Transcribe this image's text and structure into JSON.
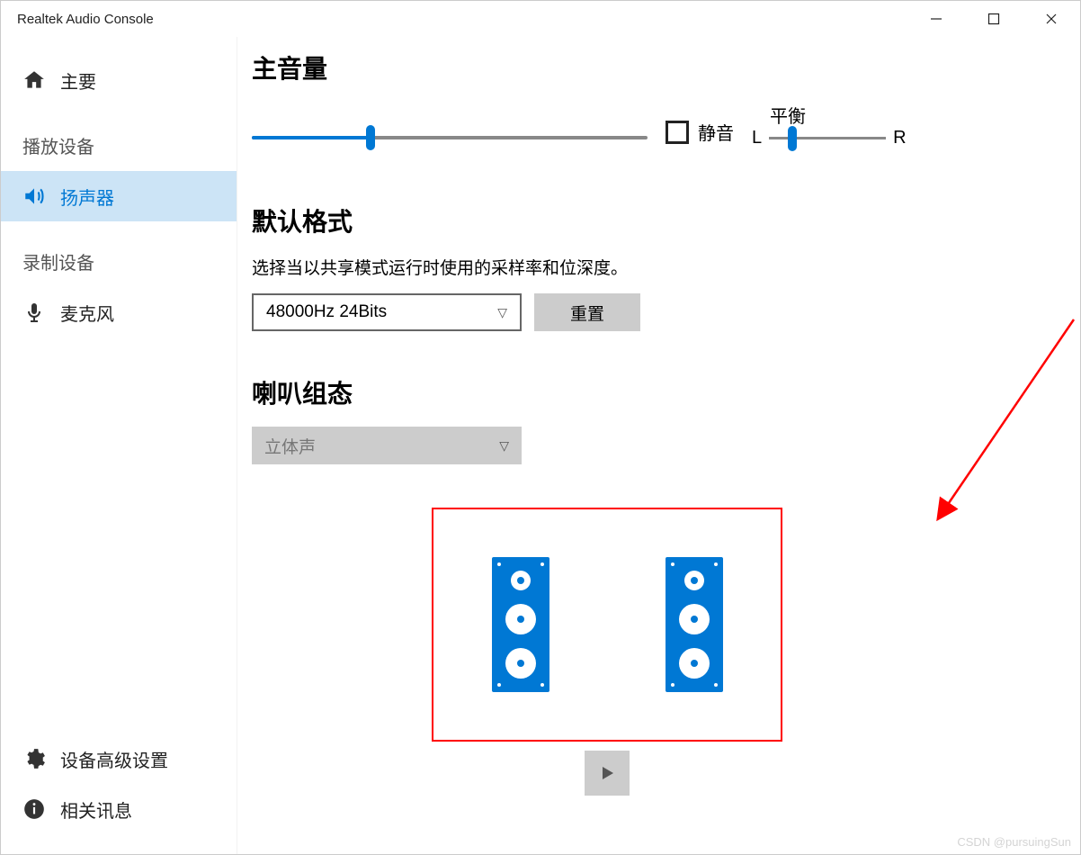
{
  "window": {
    "title": "Realtek Audio Console"
  },
  "sidebar": {
    "main": "主要",
    "playback_section": "播放设备",
    "speaker": "扬声器",
    "record_section": "录制设备",
    "microphone": "麦克风",
    "advanced": "设备高级设置",
    "info": "相关讯息"
  },
  "main": {
    "volume_title": "主音量",
    "volume_percent": 30,
    "mute_label": "静音",
    "balance_label": "平衡",
    "balance_left": "L",
    "balance_right": "R",
    "balance_percent": 20,
    "format_title": "默认格式",
    "format_desc": "选择当以共享模式运行时使用的采样率和位深度。",
    "format_value": "48000Hz 24Bits",
    "reset_label": "重置",
    "config_title": "喇叭组态",
    "config_value": "立体声"
  },
  "watermark": "CSDN @pursuingSun"
}
